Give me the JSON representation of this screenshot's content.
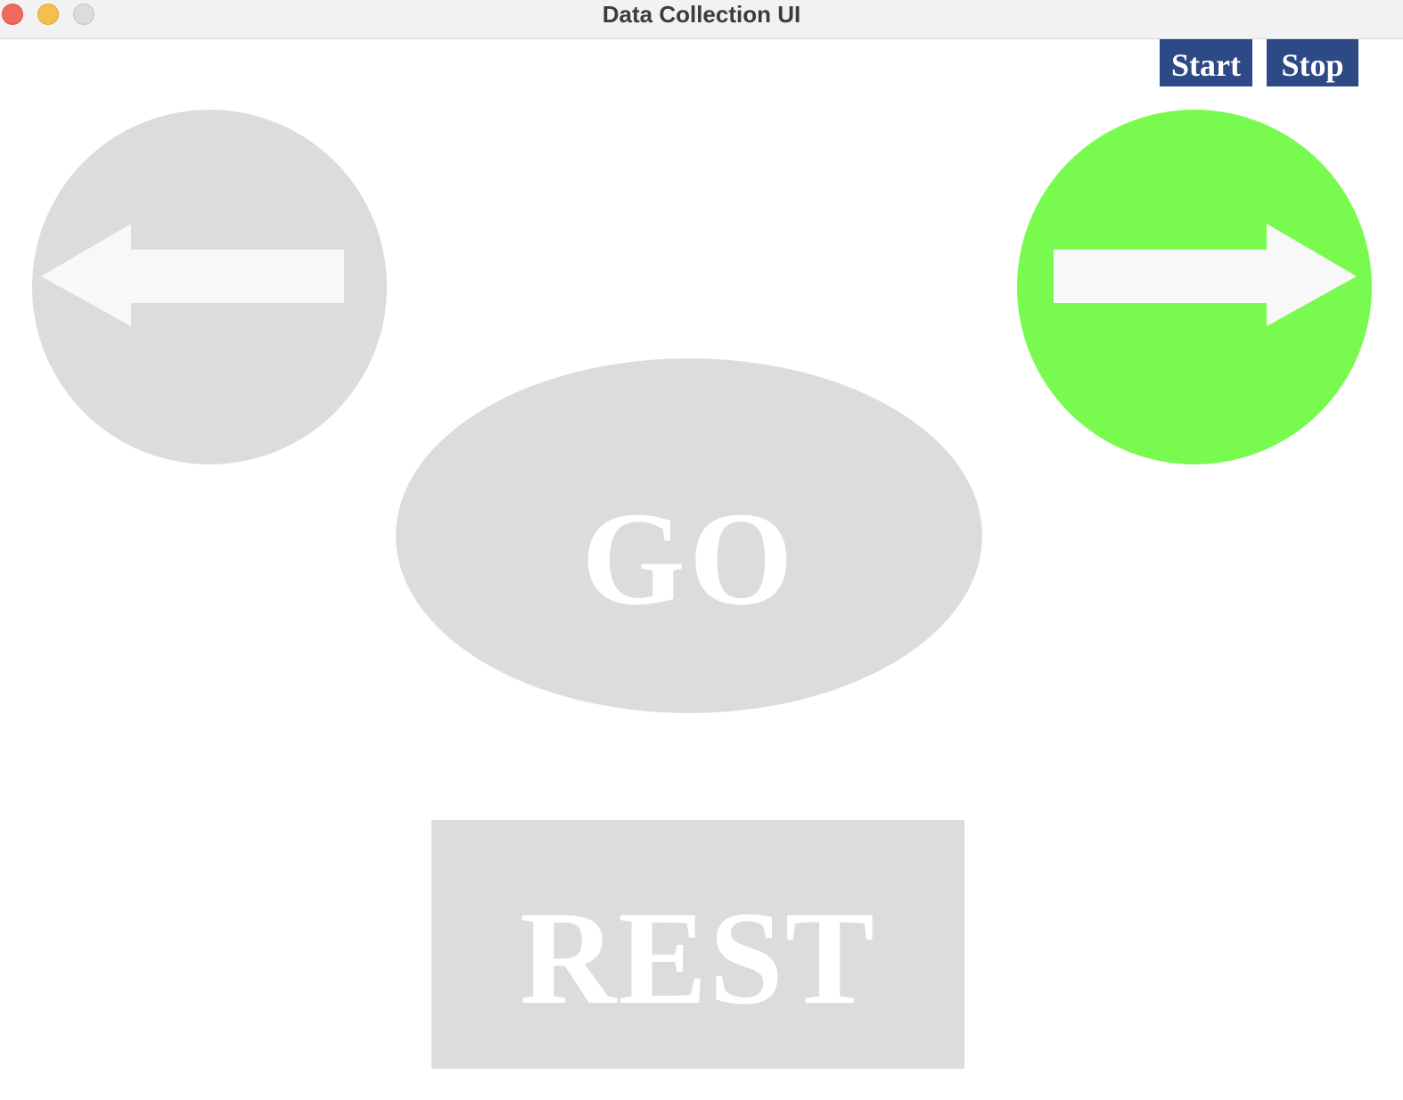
{
  "window": {
    "title": "Data Collection UI"
  },
  "controls": {
    "start_label": "Start",
    "stop_label": "Stop",
    "button_color": "#2d4a86"
  },
  "cues": {
    "left": {
      "icon": "arrow-left-icon",
      "active": false
    },
    "right": {
      "icon": "arrow-right-icon",
      "active": true
    },
    "go": {
      "label": "GO",
      "active": false
    },
    "rest": {
      "label": "REST",
      "active": false
    }
  },
  "colors": {
    "inactive": "#dcdcdc",
    "active": "#78fa4f",
    "arrow": "#f8f8f8",
    "label_text": "#ffffff"
  }
}
